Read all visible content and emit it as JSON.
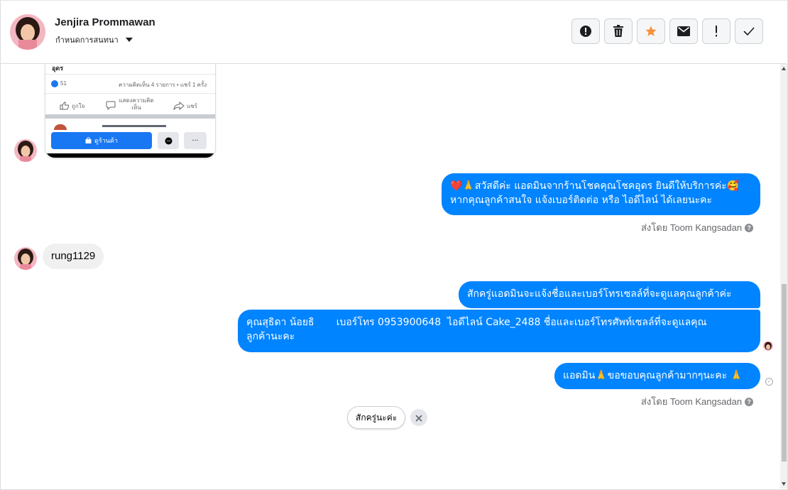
{
  "header": {
    "name": "Jenjira Prommawan",
    "subtitle": "กำหนดการสนทนา",
    "actions": [
      "alert-icon",
      "trash-icon",
      "star-icon",
      "envelope-icon",
      "exclamation-icon",
      "check-icon"
    ],
    "star_color": "#f7923b"
  },
  "shared_post": {
    "city": "อุดร",
    "likes": "51",
    "stats": "ความคิดเห็น 4 รายการ • แชร์ 1 ครั้ง",
    "like_label": "ถูกใจ",
    "comment_label": "แสดงความคิดเห็น",
    "share_label": "แชร์",
    "shop_label": "ดูร้านค้า",
    "more_label": "···"
  },
  "messages": {
    "greeting_line1": "❤️🙏สวัสดีค่ะ แอดมินจากร้านโชคคุณโชคอุดร ยินดีให้บริการค่ะ🥰",
    "greeting_line2": "หากคุณลูกค้าสนใจ แจ้งเบอร์ติดต่อ หรือ ไอดีไลน์ ได้เลยนะคะ",
    "sent_by_1": "ส่งโดย Toom Kangsadan",
    "customer_reply": "rung1129",
    "wait": "สักครู่แอดมินจะแจ้งชื่อและเบอร์โทรเซลล์ที่จะดูแลคุณลูกค้าค่ะ",
    "contact_line1": "คุณสุธิดา น้อยธิ       เบอร์โทร 0953900648  ไอดีไลน์ Cake_2488 ชื่อและเบอร์โทรศัพท์เซลล์ที่จะดูแลคุณ",
    "contact_line2": "ลูกค้านะคะ",
    "thanks": "แอดมิน🙏ขอขอบคุณลูกค้ามากๆนะคะ 🙏",
    "sent_by_2": "ส่งโดย Toom Kangsadan"
  },
  "quick_reply": {
    "label": "สักครู่นะค่ะ"
  },
  "colors": {
    "bubble_out": "#0084ff",
    "bubble_in": "#f0f0f0",
    "shop_button": "#1877f2"
  }
}
